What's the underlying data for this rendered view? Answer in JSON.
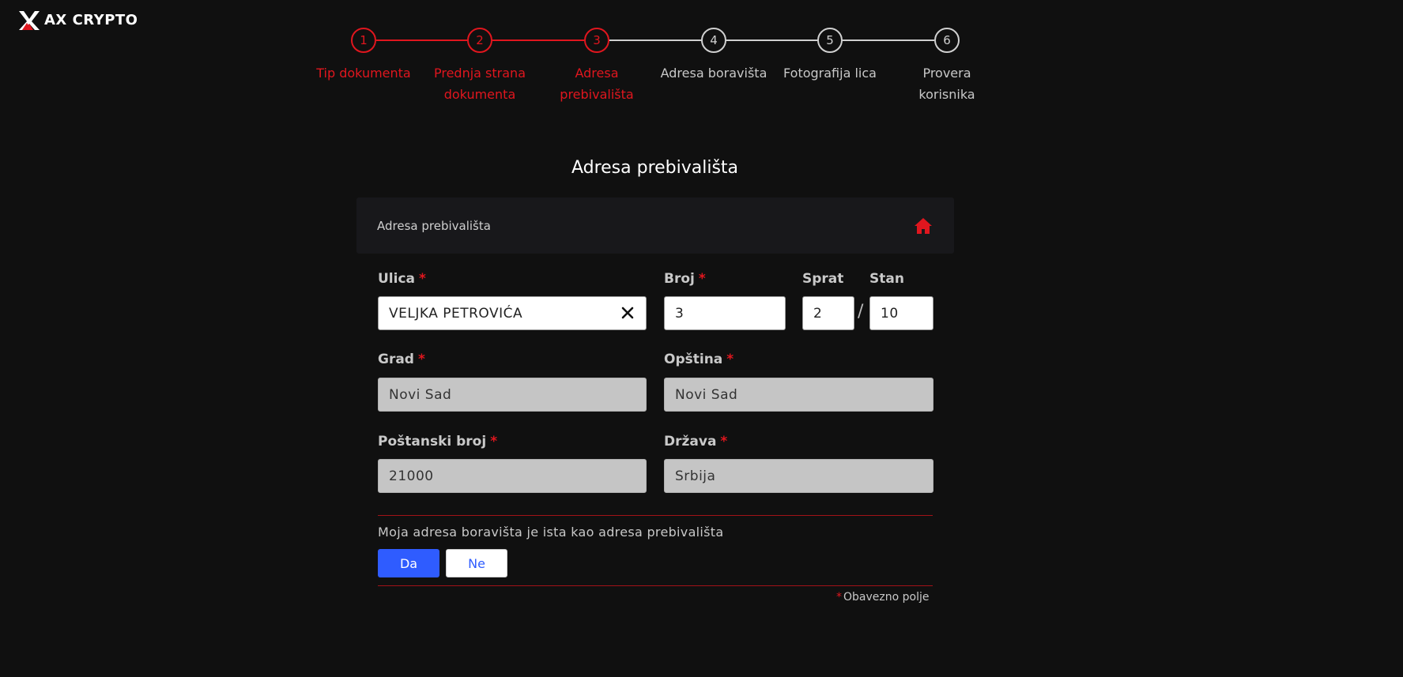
{
  "brand": {
    "name": "AX CRYPTO"
  },
  "colors": {
    "accent": "#e0161e",
    "primary_button": "#2f5cff",
    "background": "#101010"
  },
  "stepper": {
    "steps": [
      {
        "number": "1",
        "label": "Tip dokumenta",
        "state": "done"
      },
      {
        "number": "2",
        "label": "Prednja strana dokumenta",
        "state": "done"
      },
      {
        "number": "3",
        "label": "Adresa prebivališta",
        "state": "current"
      },
      {
        "number": "4",
        "label": "Adresa boravišta",
        "state": "pending"
      },
      {
        "number": "5",
        "label": "Fotografija lica",
        "state": "pending"
      },
      {
        "number": "6",
        "label": "Provera korisnika",
        "state": "pending"
      }
    ]
  },
  "page": {
    "title": "Adresa prebivališta"
  },
  "section": {
    "label": "Adresa prebivališta",
    "icon": "home-icon"
  },
  "form": {
    "street": {
      "label": "Ulica",
      "value": "VELJKA PETROVIĆA",
      "required": true
    },
    "number": {
      "label": "Broj",
      "value": "3",
      "required": true
    },
    "floor": {
      "label": "Sprat",
      "value": "2"
    },
    "apartment": {
      "label": "Stan",
      "value": "10"
    },
    "separator": "/",
    "city": {
      "label": "Grad",
      "value": "Novi Sad",
      "required": true
    },
    "municipality": {
      "label": "Opština",
      "value": "Novi Sad",
      "required": true
    },
    "postal_code": {
      "label": "Poštanski broj",
      "value": "21000",
      "required": true
    },
    "country": {
      "label": "Država",
      "value": "Srbija",
      "required": true
    },
    "required_marker": "*"
  },
  "same_address": {
    "question": "Moja adresa boravišta je ista kao adresa prebivališta",
    "yes_label": "Da",
    "no_label": "Ne",
    "selected": "Da"
  },
  "footer": {
    "required_note": "Obavezno polje"
  }
}
